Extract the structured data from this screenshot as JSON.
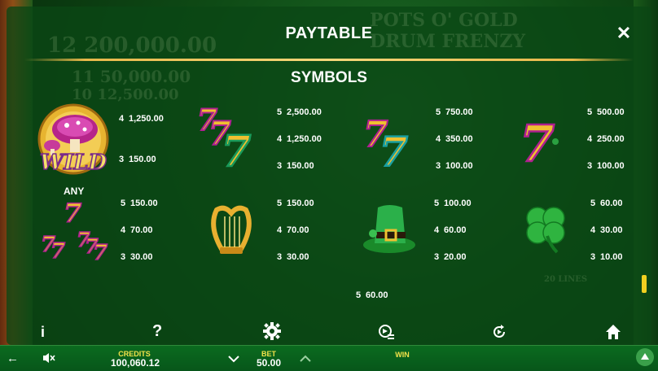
{
  "header": {
    "title": "PAYTABLE",
    "close_icon": "close-icon"
  },
  "section": {
    "title": "SYMBOLS"
  },
  "background": {
    "jackpot_amounts": [
      "12 200,000.00",
      "11 50,000.00",
      "10 12,500.00"
    ],
    "game_title": "POTS O' GOLD DRUM FRENZY",
    "lines_label": "20 LINES"
  },
  "symbols": [
    {
      "name": "wild",
      "label": "WILD",
      "pays": [
        {
          "count": "4",
          "amount": "1,250.00"
        },
        {
          "count": "3",
          "amount": "150.00"
        }
      ]
    },
    {
      "name": "triple-seven",
      "pays": [
        {
          "count": "5",
          "amount": "2,500.00"
        },
        {
          "count": "4",
          "amount": "1,250.00"
        },
        {
          "count": "3",
          "amount": "150.00"
        }
      ]
    },
    {
      "name": "double-seven",
      "pays": [
        {
          "count": "5",
          "amount": "750.00"
        },
        {
          "count": "4",
          "amount": "350.00"
        },
        {
          "count": "3",
          "amount": "100.00"
        }
      ]
    },
    {
      "name": "single-seven",
      "pays": [
        {
          "count": "5",
          "amount": "500.00"
        },
        {
          "count": "4",
          "amount": "250.00"
        },
        {
          "count": "3",
          "amount": "100.00"
        }
      ]
    },
    {
      "name": "any-seven",
      "label": "ANY",
      "pays": [
        {
          "count": "5",
          "amount": "150.00"
        },
        {
          "count": "4",
          "amount": "70.00"
        },
        {
          "count": "3",
          "amount": "30.00"
        }
      ]
    },
    {
      "name": "harp",
      "pays": [
        {
          "count": "5",
          "amount": "150.00"
        },
        {
          "count": "4",
          "amount": "70.00"
        },
        {
          "count": "3",
          "amount": "30.00"
        }
      ]
    },
    {
      "name": "leprechaun-hat",
      "pays": [
        {
          "count": "5",
          "amount": "100.00"
        },
        {
          "count": "4",
          "amount": "60.00"
        },
        {
          "count": "3",
          "amount": "20.00"
        }
      ]
    },
    {
      "name": "clover",
      "pays": [
        {
          "count": "5",
          "amount": "60.00"
        },
        {
          "count": "4",
          "amount": "30.00"
        },
        {
          "count": "3",
          "amount": "10.00"
        }
      ]
    }
  ],
  "extra_pay": {
    "count": "5",
    "amount": "60.00"
  },
  "toolbar_icons": [
    "info-icon",
    "help-icon",
    "settings-icon",
    "autoplay-icon",
    "replay-icon",
    "home-icon"
  ],
  "bottom_bar": {
    "credits_label": "CREDITS",
    "credits_value": "100,060.12",
    "bet_label": "BET",
    "bet_value": "50.00",
    "win_label": "WIN",
    "win_value": ""
  },
  "colors": {
    "accent_yellow": "#f2e24a",
    "panel_green": "#0a4614",
    "gold": "#e8b84a"
  }
}
